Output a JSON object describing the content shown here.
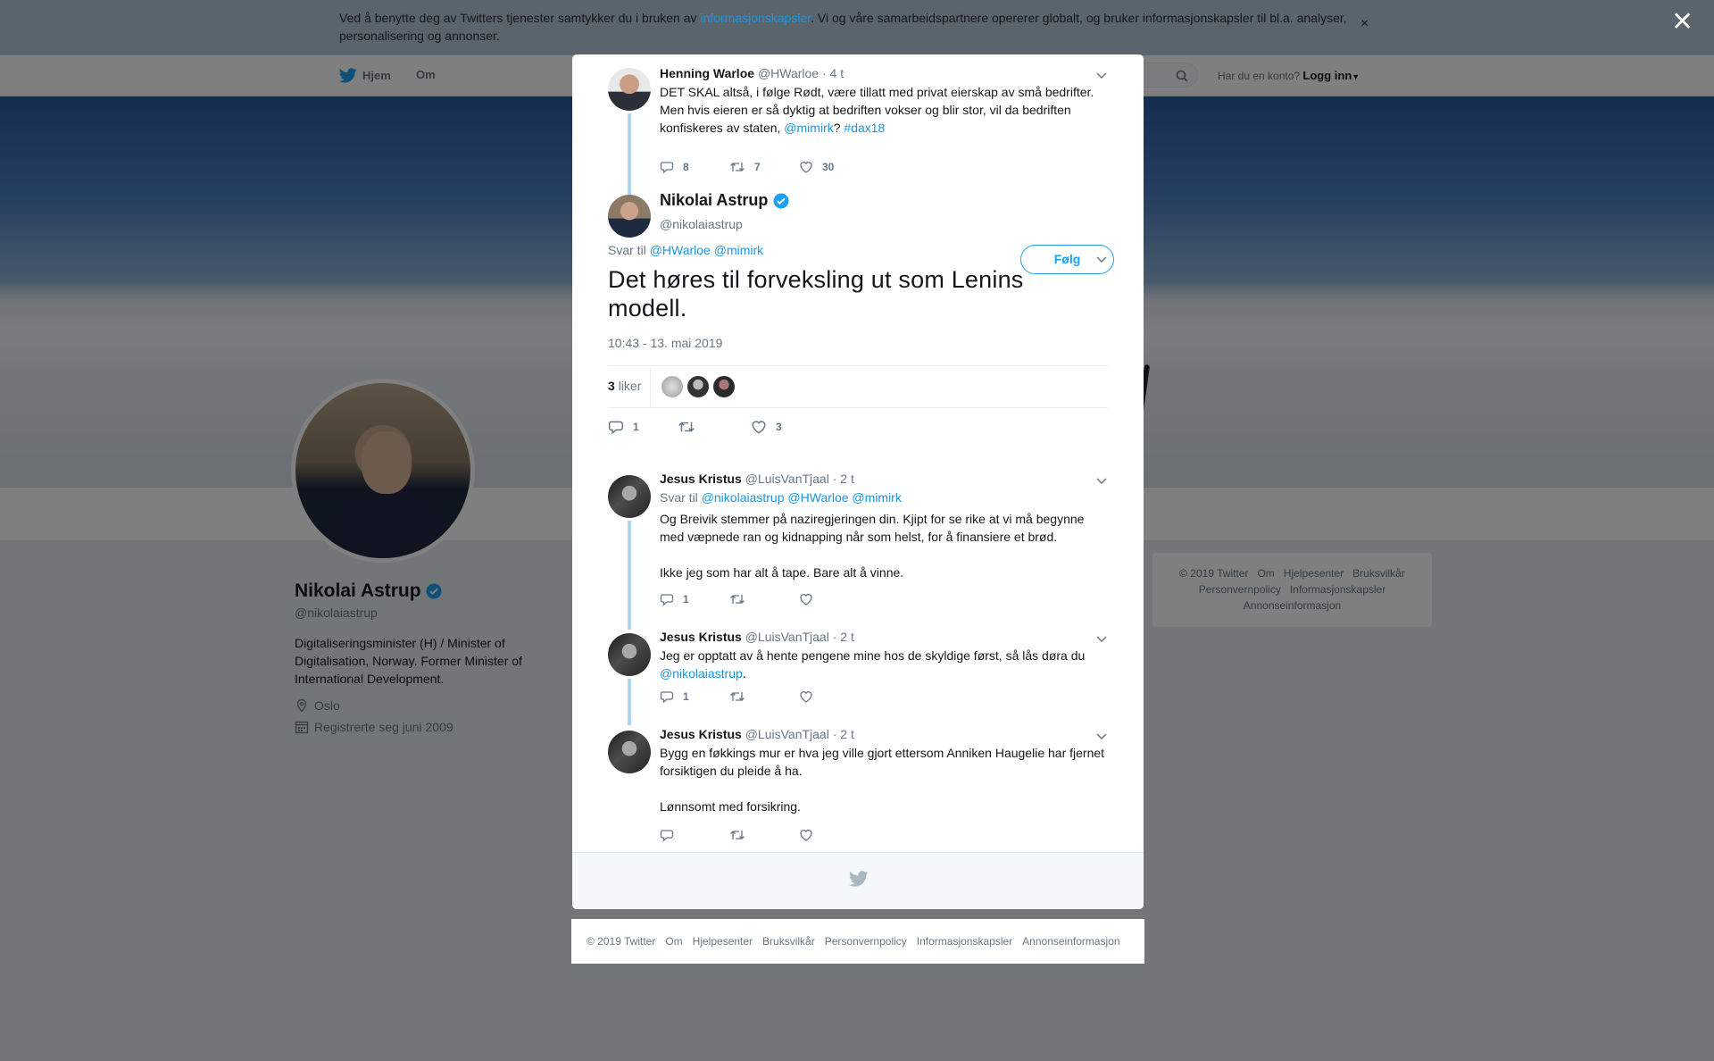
{
  "cookie_banner": {
    "text_before": "Ved å benytte deg av Twitters tjenester samtykker du i bruken av ",
    "link": "informasjonskapsler",
    "text_after": ". Vi og våre samarbeidspartnere opererer globalt, og bruker informasjonskapsler til bl.a. analyser, personalisering og annonser.",
    "close_glyph": "×"
  },
  "overlay_close_glyph": "✕",
  "topnav": {
    "home": "Hjem",
    "about": "Om",
    "have_account": "Har du en konto?",
    "login": "Logg inn"
  },
  "profile": {
    "name": "Nikolai Astrup",
    "handle": "@nikolaiastrup",
    "bio": "Digitaliseringsminister (H) / Minister of Digitalisation, Norway. Former Minister of International Development.",
    "location": "Oslo",
    "joined": "Registrerte seg juni 2009"
  },
  "side_footer": {
    "line1": [
      "© 2019 Twitter",
      "Om",
      "Hjelpesenter",
      "Bruksvilkår"
    ],
    "line2": [
      "Personvernpolicy",
      "Informasjonskapsler"
    ],
    "line3": [
      "Annonseinformasjon"
    ]
  },
  "parent_tweet": {
    "name": "Henning Warloe",
    "handle": "@HWarloe",
    "time": "· 4 t",
    "text": "DET SKAL altså, i følge Rødt, være tillatt med privat eierskap av små bedrifter. Men hvis eieren er så dyktig at bedriften vokser og blir stor, vil da bedriften konfiskeres av staten, ",
    "mention": "@mimirk",
    "q": "?",
    "hashtag": "#dax18",
    "replies": "8",
    "retweets": "7",
    "likes": "30"
  },
  "main_tweet": {
    "name": "Nikolai Astrup",
    "handle": "@nikolaiastrup",
    "follow": "Følg",
    "reply_to_label": "Svar til",
    "reply_to_1": "@HWarloe",
    "reply_to_2": "@mimirk",
    "text": "Det høres til forveksling ut som Lenins modell.",
    "timestamp": "10:43 - 13. mai 2019",
    "like_count": "3",
    "like_label": "liker",
    "replies": "1",
    "retweets": "",
    "likes": "3"
  },
  "replies": [
    {
      "name": "Jesus Kristus",
      "handle": "@LuisVanTjaal",
      "time": "· 2 t",
      "reply_to_label": "Svar til",
      "reply_to": "@nikolaiastrup @HWarloe @mimirk",
      "text1": "Og Breivik stemmer på naziregjeringen din. Kjipt for se rike at vi må begynne med væpnede ran og kidnapping når som helst, for å finansiere et brød.",
      "text2": "Ikke jeg som har alt å tape. Bare alt å vinne.",
      "replies": "1"
    },
    {
      "name": "Jesus Kristus",
      "handle": "@LuisVanTjaal",
      "time": "· 2 t",
      "text1": "Jeg er opptatt av å hente pengene mine hos de skyldige først, så lås døra du ",
      "mention": "@nikolaiastrup",
      "text_end": ".",
      "replies": "1"
    },
    {
      "name": "Jesus Kristus",
      "handle": "@LuisVanTjaal",
      "time": "· 2 t",
      "text1": "Bygg en føkkings mur er hva jeg ville gjort ettersom Anniken Haugelie har fjernet forsiktigen du pleide å ha.",
      "text2": "Lønnsomt med forsikring."
    }
  ],
  "modal_footer": [
    "© 2019 Twitter",
    "Om",
    "Hjelpesenter",
    "Bruksvilkår",
    "Personvernpolicy",
    "Informasjonskapsler",
    "Annonseinformasjon"
  ],
  "colors": {
    "brand": "#1da1f2",
    "link": "#1b95e0",
    "thread_line": "#a9d7ee",
    "verified": "#1da1f2"
  },
  "icons": [
    "twitter-bird-icon",
    "search-icon",
    "reply-icon",
    "retweet-icon",
    "like-icon",
    "chevron-down-icon",
    "verified-badge-icon",
    "location-icon",
    "calendar-icon",
    "close-icon"
  ]
}
